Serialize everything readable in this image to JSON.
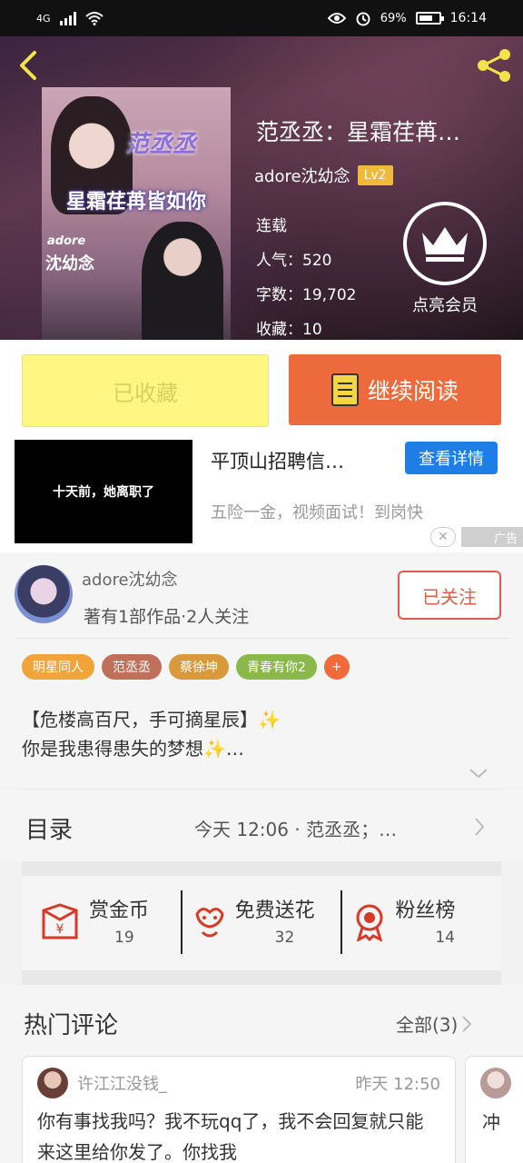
{
  "status_bar": {
    "network": "4G",
    "battery": "69%",
    "time": "16:14"
  },
  "book": {
    "title": "范丞丞：星霜荏苒…",
    "author": "adore沈幼念",
    "level": "Lv2",
    "status": "连载",
    "popularity": "人气：520",
    "word_count": "字数：19,702",
    "favorites": "收藏：10",
    "vip_label": "点亮会员",
    "cover": {
      "name_text": "范丞丞",
      "title_text": "星霜荏苒皆如你",
      "author_small": "adore",
      "author_text": "沈幼念"
    }
  },
  "actions": {
    "favorite_label": "已收藏",
    "read_label": "继续阅读"
  },
  "ad": {
    "thumb_text": "十天前，她离职了",
    "title": "平顶山招聘信…",
    "button": "查看详情",
    "description": "五险一金，视频面试！到岗快",
    "badge": "广告"
  },
  "author_section": {
    "name": "adore沈幼念",
    "info": "著有1部作品·2人关注",
    "follow_label": "已关注",
    "tags": [
      {
        "label": "明星同人",
        "color": "#f0a43a"
      },
      {
        "label": "范丞丞",
        "color": "#c0705a"
      },
      {
        "label": "蔡徐坤",
        "color": "#d89a3a"
      },
      {
        "label": "青春有你2",
        "color": "#8ab84a"
      },
      {
        "label": "+",
        "color": "#f06a3a"
      }
    ],
    "intro_line1": "【危楼高百尺，手可摘星辰】✨",
    "intro_line2": "你是我患得患失的梦想✨…"
  },
  "catalog": {
    "label": "目录",
    "latest": "今天 12:06 · 范丞丞；…"
  },
  "stats": [
    {
      "label": "赏金币",
      "value": "19",
      "icon": "reward-coin-icon"
    },
    {
      "label": "免费送花",
      "value": "32",
      "icon": "flower-icon"
    },
    {
      "label": "粉丝榜",
      "value": "14",
      "icon": "fan-rank-icon"
    }
  ],
  "comments": {
    "title": "热门评论",
    "all_label": "全部(3)",
    "items": [
      {
        "user": "许江江没钱_",
        "time": "昨天 12:50",
        "text": "你有事找我吗？我不玩qq了，我不会回复就只能来这里给你发了。你找我"
      },
      {
        "text": "冲"
      }
    ]
  },
  "colors": {
    "accent_orange": "#ec6a3c",
    "favorite_yellow": "#fff781",
    "ad_blue": "#1f7ee6",
    "follow_red": "#e25b48"
  }
}
